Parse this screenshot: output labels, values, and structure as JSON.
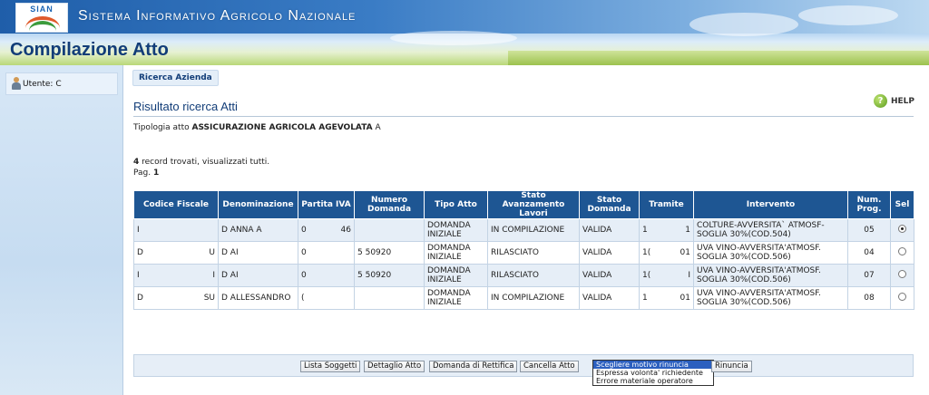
{
  "header": {
    "logo_text": "SIAN",
    "system_title": "Sistema Informativo Agricolo Nazionale",
    "page_title": "Compilazione Atto"
  },
  "sidebar": {
    "user_label": "Utente: C"
  },
  "tabs": [
    {
      "label": "Ricerca Azienda"
    }
  ],
  "main": {
    "section_title": "Risultato ricerca Atti",
    "help_label": "HELP",
    "tipologia_label": "Tipologia atto",
    "tipologia_value": "ASSICURAZIONE AGRICOLA AGEVOLATA",
    "tipologia_suffix": "A",
    "records_count": "4",
    "records_text": "record trovati, visualizzati tutti.",
    "page_label": "Pag.",
    "page_number": "1"
  },
  "table": {
    "columns": [
      "Codice Fiscale",
      "Denominazione",
      "Partita IVA",
      "Numero Domanda",
      "Tipo Atto",
      "Stato Avanzamento Lavori",
      "Stato Domanda",
      "Tramite",
      "Intervento",
      "Num. Prog.",
      "Sel"
    ],
    "rows": [
      {
        "codice_fiscale": "I",
        "denominazione": "D ANNA A",
        "partita_iva": "0",
        "partita_iva_tail": "46",
        "numero_domanda": "",
        "tipo_atto": "DOMANDA INIZIALE",
        "stato_lavori": "IN COMPILAZIONE",
        "stato_domanda": "VALIDA",
        "tramite": "1",
        "tramite_tail": "1",
        "intervento": "COLTURE-AVVERSITA` ATMOSF-SOGLIA 30%(COD.504)",
        "num_prog": "05",
        "selected": true
      },
      {
        "codice_fiscale": "D",
        "codice_fiscale_tail": "U",
        "denominazione": "D AI",
        "partita_iva": "0",
        "partita_iva_tail": "",
        "numero_domanda": "5 50920",
        "tipo_atto": "DOMANDA INIZIALE",
        "stato_lavori": "RILASCIATO",
        "stato_domanda": "VALIDA",
        "tramite": "1(",
        "tramite_tail": "01",
        "intervento": "UVA VINO-AVVERSITA'ATMOSF. SOGLIA 30%(COD.506)",
        "num_prog": "04",
        "selected": false
      },
      {
        "codice_fiscale": "I",
        "codice_fiscale_tail": "I",
        "denominazione": "D AI",
        "partita_iva": "0",
        "partita_iva_tail": "",
        "numero_domanda": "5 50920",
        "tipo_atto": "DOMANDA INIZIALE",
        "stato_lavori": "RILASCIATO",
        "stato_domanda": "VALIDA",
        "tramite": "1(",
        "tramite_tail": "I",
        "intervento": "UVA VINO-AVVERSITA'ATMOSF. SOGLIA 30%(COD.506)",
        "num_prog": "07",
        "selected": false
      },
      {
        "codice_fiscale": "D",
        "codice_fiscale_tail": "SU",
        "denominazione": "D ALLESSANDRO",
        "partita_iva": "(",
        "partita_iva_tail": "",
        "numero_domanda": "",
        "tipo_atto": "DOMANDA INIZIALE",
        "stato_lavori": "IN COMPILAZIONE",
        "stato_domanda": "VALIDA",
        "tramite": "1",
        "tramite_tail": "01",
        "intervento": "UVA VINO-AVVERSITA'ATMOSF. SOGLIA 30%(COD.506)",
        "num_prog": "08",
        "selected": false
      }
    ]
  },
  "actions": {
    "lista_soggetti": "Lista Soggetti",
    "dettaglio_atto": "Dettaglio Atto",
    "domanda_rettifica": "Domanda di Rettifica",
    "cancella_atto": "Cancella Atto",
    "motivo_options": [
      "Scegliere motivo rinuncia",
      "Espressa volonta' richiedente",
      "Errore materiale operatore"
    ],
    "rinuncia": "Rinuncia"
  }
}
